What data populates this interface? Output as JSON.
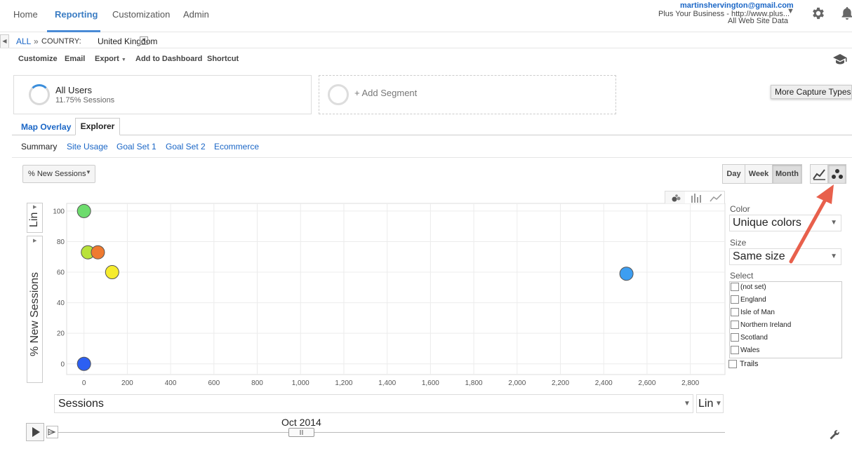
{
  "nav": {
    "items": [
      "Home",
      "Reporting",
      "Customization",
      "Admin"
    ],
    "active": "Reporting",
    "account_email": "martinshervington@gmail.com",
    "property": "Plus Your Business - http://www.plus...",
    "view": "All Web Site Data"
  },
  "breadcrumb": {
    "all": "ALL",
    "separator": "»",
    "dimension": "COUNTRY:",
    "value": "United Kingdom"
  },
  "toolbar": {
    "customize": "Customize",
    "email": "Email",
    "export": "Export",
    "add_to_dashboard": "Add to Dashboard",
    "shortcut": "Shortcut"
  },
  "segments": {
    "all_users": "All Users",
    "all_users_sub": "11.75% Sessions",
    "add_segment": "+ Add Segment"
  },
  "tooltip": "More Capture Types",
  "tabs": [
    "Map Overlay",
    "Explorer"
  ],
  "subtabs": [
    "Summary",
    "Site Usage",
    "Goal Set 1",
    "Goal Set 2",
    "Ecommerce"
  ],
  "metric_select": "% New Sessions",
  "periods": [
    "Day",
    "Week",
    "Month"
  ],
  "selected_period": "Month",
  "y_scale": "Lin",
  "x_scale": "Lin",
  "x_metric": "Sessions",
  "right_panel": {
    "color_label": "Color",
    "color_value": "Unique colors",
    "size_label": "Size",
    "size_value": "Same size",
    "select_label": "Select",
    "options": [
      "(not set)",
      "England",
      "Isle of Man",
      "Northern Ireland",
      "Scotland",
      "Wales"
    ],
    "trails": "Trails"
  },
  "timeline": {
    "label": "Oct 2014"
  },
  "colors": {
    "accent": "#3a7cc3",
    "arrow": "#e8604c"
  },
  "chart_data": {
    "type": "scatter",
    "ylabel": "% New Sessions",
    "xlabel": "Sessions",
    "xlim": [
      -80,
      2960
    ],
    "ylim": [
      -7,
      105
    ],
    "xticks": [
      0,
      200,
      400,
      600,
      800,
      1000,
      1200,
      1400,
      1600,
      1800,
      2000,
      2200,
      2400,
      2600,
      2800
    ],
    "xtick_labels": [
      "0",
      "200",
      "400",
      "600",
      "800",
      "1,000",
      "1,200",
      "1,400",
      "1,600",
      "1,800",
      "2,000",
      "2,200",
      "2,400",
      "2,600",
      "2,800"
    ],
    "yticks": [
      0,
      20,
      40,
      60,
      80,
      100
    ],
    "grid": true,
    "points": [
      {
        "x": 0,
        "y": 100,
        "color": "#6ddc6d"
      },
      {
        "x": 18,
        "y": 73,
        "color": "#b9e23b"
      },
      {
        "x": 64,
        "y": 73,
        "color": "#ef7a30"
      },
      {
        "x": 130,
        "y": 60,
        "color": "#f6ec2e"
      },
      {
        "x": 2505,
        "y": 59,
        "color": "#3d9ef1"
      },
      {
        "x": 0,
        "y": 0,
        "color": "#2c5ff2"
      }
    ]
  }
}
